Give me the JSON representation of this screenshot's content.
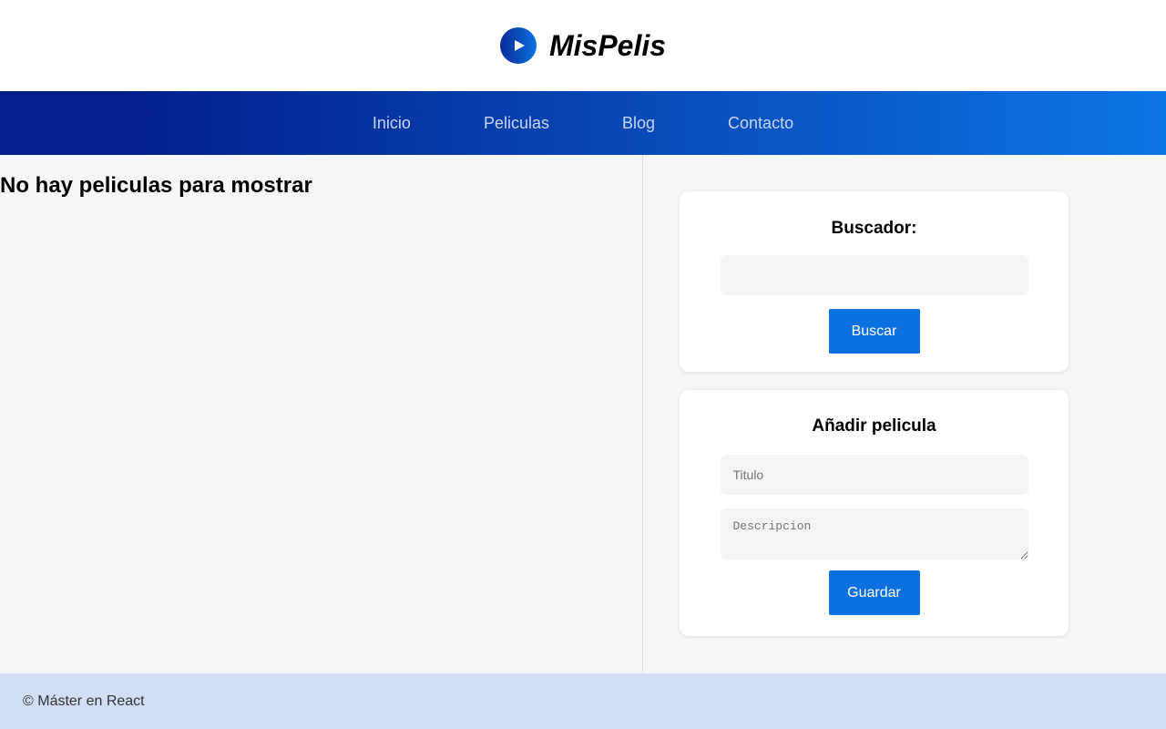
{
  "header": {
    "brand": "MisPelis"
  },
  "nav": {
    "items": [
      "Inicio",
      "Peliculas",
      "Blog",
      "Contacto"
    ]
  },
  "content": {
    "empty_message": "No hay peliculas para mostrar"
  },
  "search": {
    "title": "Buscador:",
    "input_value": "",
    "button": "Buscar"
  },
  "add": {
    "title": "Añadir pelicula",
    "title_placeholder": "Titulo",
    "description_placeholder": "Descripcion",
    "button": "Guardar"
  },
  "footer": {
    "text": "© Máster en React"
  }
}
